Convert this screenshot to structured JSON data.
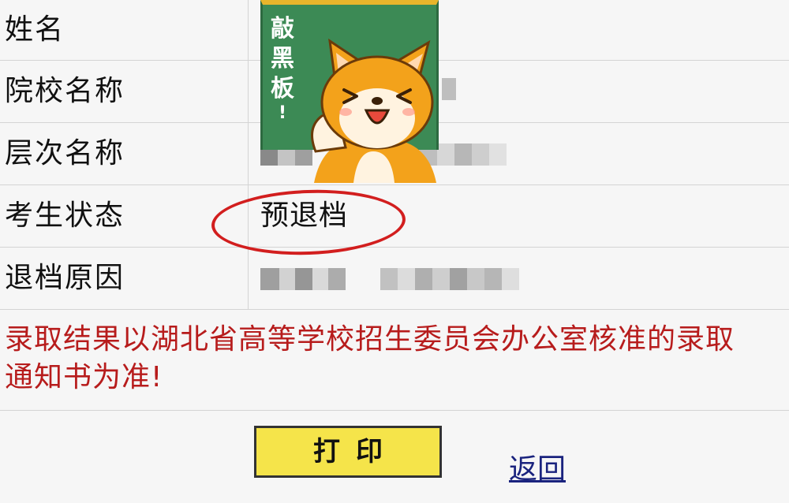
{
  "table": {
    "rows": [
      {
        "label": "姓名"
      },
      {
        "label": "院校名称"
      },
      {
        "label": "层次名称"
      },
      {
        "label": "考生状态",
        "value": "预退档"
      },
      {
        "label": "退档原因"
      }
    ]
  },
  "sticker": {
    "text": [
      "敲",
      "黑",
      "板",
      "!"
    ]
  },
  "notice": {
    "line1": "录取结果以湖北省高等学校招生委员会办公室核准的录取",
    "line2": "通知书为准!"
  },
  "actions": {
    "print_label": "打印",
    "back_label": "返回"
  },
  "colors": {
    "notice": "#b71c1c",
    "highlight_circle": "#d21e1e",
    "print_button": "#f5e44a",
    "link": "#1a237e",
    "board": "#3c8a55"
  },
  "icons": [
    "dog-sticker-icon",
    "chalkboard-icon"
  ]
}
